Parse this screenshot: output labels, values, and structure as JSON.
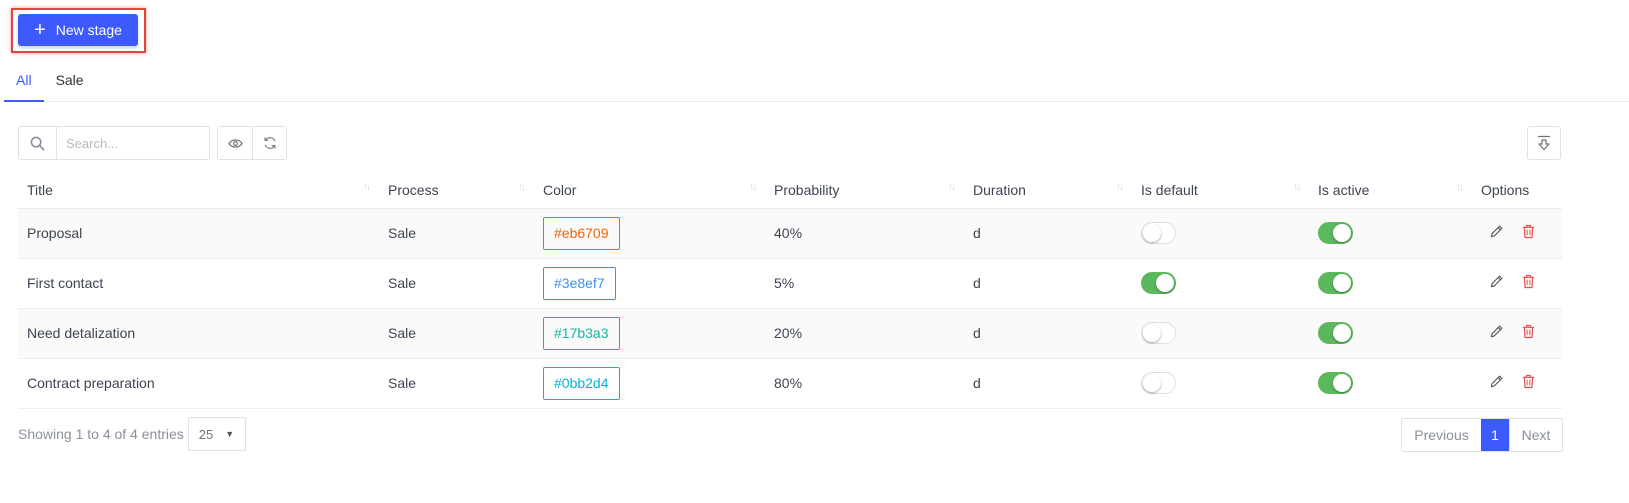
{
  "toolbar": {
    "new_stage_label": "New stage",
    "search_placeholder": "Search..."
  },
  "tabs": [
    {
      "label": "All",
      "active": true
    },
    {
      "label": "Sale",
      "active": false
    }
  ],
  "table": {
    "headers": [
      "Title",
      "Process",
      "Color",
      "Probability",
      "Duration",
      "Is default",
      "Is active",
      "Options"
    ],
    "rows": [
      {
        "title": "Proposal",
        "process": "Sale",
        "color": "#eb6709",
        "probability": "40%",
        "duration": "d",
        "is_default": false,
        "is_active": true
      },
      {
        "title": "First contact",
        "process": "Sale",
        "color": "#3e8ef7",
        "probability": "5%",
        "duration": "d",
        "is_default": true,
        "is_active": true
      },
      {
        "title": "Need detalization",
        "process": "Sale",
        "color": "#17b3a3",
        "probability": "20%",
        "duration": "d",
        "is_default": false,
        "is_active": true
      },
      {
        "title": "Contract preparation",
        "process": "Sale",
        "color": "#0bb2d4",
        "probability": "80%",
        "duration": "d",
        "is_default": false,
        "is_active": true
      }
    ]
  },
  "footer": {
    "info": "Showing 1 to 4 of 4 entries",
    "per_page": "25",
    "previous_label": "Previous",
    "current_page": "1",
    "next_label": "Next"
  },
  "colors": {
    "primary": "#3d5afe",
    "toggle_on": "#5cb85c",
    "delete": "#e84c4c"
  },
  "icons": {
    "add": "plus-icon",
    "search": "search-icon",
    "visibility": "eye-icon",
    "refresh": "refresh-icon",
    "export": "export-icon",
    "edit": "pencil-icon",
    "delete": "trash-icon"
  }
}
